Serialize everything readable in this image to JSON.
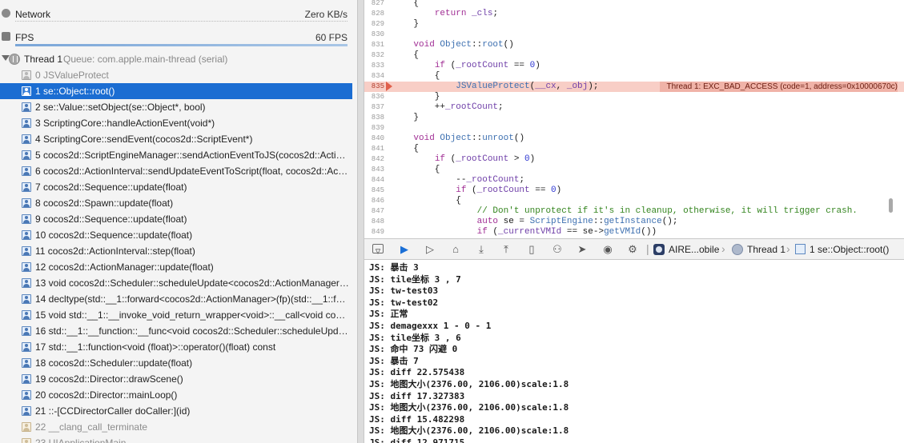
{
  "navigator": {
    "gauges": [
      {
        "name": "Network",
        "value": "Zero KB/s",
        "icon": "network-gauge-icon",
        "level": 0.0
      },
      {
        "name": "FPS",
        "value": "60 FPS",
        "icon": "fps-gauge-icon",
        "level": 1.0
      }
    ],
    "thread": {
      "name": "Thread 1",
      "queue": "Queue: com.apple.main-thread (serial)",
      "icon": "thread-icon"
    },
    "frames": [
      {
        "label": "0 JSValueProtect",
        "style": "dim",
        "icon": "grey"
      },
      {
        "label": "1 se::Object::root()",
        "style": "selected",
        "icon": "blue"
      },
      {
        "label": "2 se::Value::setObject(se::Object*, bool)",
        "style": "normal",
        "icon": "blue"
      },
      {
        "label": "3 ScriptingCore::handleActionEvent(void*)",
        "style": "normal",
        "icon": "blue"
      },
      {
        "label": "4 ScriptingCore::sendEvent(cocos2d::ScriptEvent*)",
        "style": "normal",
        "icon": "blue"
      },
      {
        "label": "5 cocos2d::ScriptEngineManager::sendActionEventToJS(cocos2d::Action...",
        "style": "normal",
        "icon": "blue"
      },
      {
        "label": "6 cocos2d::ActionInterval::sendUpdateEventToScript(float, cocos2d::Acti...",
        "style": "normal",
        "icon": "blue"
      },
      {
        "label": "7 cocos2d::Sequence::update(float)",
        "style": "normal",
        "icon": "blue"
      },
      {
        "label": "8 cocos2d::Spawn::update(float)",
        "style": "normal",
        "icon": "blue"
      },
      {
        "label": "9 cocos2d::Sequence::update(float)",
        "style": "normal",
        "icon": "blue"
      },
      {
        "label": "10 cocos2d::Sequence::update(float)",
        "style": "normal",
        "icon": "blue"
      },
      {
        "label": "11 cocos2d::ActionInterval::step(float)",
        "style": "normal",
        "icon": "blue"
      },
      {
        "label": "12 cocos2d::ActionManager::update(float)",
        "style": "normal",
        "icon": "blue"
      },
      {
        "label": "13 void cocos2d::Scheduler::scheduleUpdate<cocos2d::ActionManager>...",
        "style": "normal",
        "icon": "blue"
      },
      {
        "label": "14 decltype(std::__1::forward<cocos2d::ActionManager>(fp)(std::__1::for...",
        "style": "normal",
        "icon": "blue"
      },
      {
        "label": "15 void std::__1::__invoke_void_return_wrapper<void>::__call<void cocos2...",
        "style": "normal",
        "icon": "blue"
      },
      {
        "label": "16 std::__1::__function::__func<void cocos2d::Scheduler::scheduleUpdate...",
        "style": "normal",
        "icon": "blue"
      },
      {
        "label": "17 std::__1::function<void (float)>::operator()(float) const",
        "style": "normal",
        "icon": "blue"
      },
      {
        "label": "18 cocos2d::Scheduler::update(float)",
        "style": "normal",
        "icon": "blue"
      },
      {
        "label": "19 cocos2d::Director::drawScene()",
        "style": "normal",
        "icon": "blue"
      },
      {
        "label": "20 cocos2d::Director::mainLoop()",
        "style": "normal",
        "icon": "blue"
      },
      {
        "label": "21 ::-[CCDirectorCaller doCaller:](id)",
        "style": "normal",
        "icon": "blue"
      },
      {
        "label": "22 __clang_call_terminate",
        "style": "dim",
        "icon": "tan"
      },
      {
        "label": "23 UIApplicationMain",
        "style": "dim",
        "icon": "tan"
      }
    ]
  },
  "editor": {
    "error_line": "835",
    "error_message": "Thread 1: EXC_BAD_ACCESS (code=1, address=0x10000670c)",
    "lines": [
      {
        "n": "827",
        "html": "    {"
      },
      {
        "n": "828",
        "html": "        <span class=\"kw\">return</span> <span class=\"rf\">_cls</span>;"
      },
      {
        "n": "829",
        "html": "    }"
      },
      {
        "n": "830",
        "html": ""
      },
      {
        "n": "831",
        "html": "    <span class=\"kw\">void</span> <span class=\"ty\">Object</span>::<span class=\"ty\">root</span>()"
      },
      {
        "n": "832",
        "html": "    {"
      },
      {
        "n": "833",
        "html": "        <span class=\"kw\">if</span> (<span class=\"rf\">_rootCount</span> == <span class=\"nm\">0</span>)"
      },
      {
        "n": "834",
        "html": "        {"
      },
      {
        "n": "835",
        "html": "            <span class=\"ty\">JSValueProtect</span>(<span class=\"rf\">__cx</span>, <span class=\"rf\">_obj</span>);"
      },
      {
        "n": "836",
        "html": "        }"
      },
      {
        "n": "837",
        "html": "        ++<span class=\"rf\">_rootCount</span>;"
      },
      {
        "n": "838",
        "html": "    }"
      },
      {
        "n": "839",
        "html": ""
      },
      {
        "n": "840",
        "html": "    <span class=\"kw\">void</span> <span class=\"ty\">Object</span>::<span class=\"ty\">unroot</span>()"
      },
      {
        "n": "841",
        "html": "    {"
      },
      {
        "n": "842",
        "html": "        <span class=\"kw\">if</span> (<span class=\"rf\">_rootCount</span> > <span class=\"nm\">0</span>)"
      },
      {
        "n": "843",
        "html": "        {"
      },
      {
        "n": "844",
        "html": "            --<span class=\"rf\">_rootCount</span>;"
      },
      {
        "n": "845",
        "html": "            <span class=\"kw\">if</span> (<span class=\"rf\">_rootCount</span> == <span class=\"nm\">0</span>)"
      },
      {
        "n": "846",
        "html": "            {"
      },
      {
        "n": "847",
        "html": "                <span class=\"cm\">// Don't unprotect if it's in cleanup, otherwise, it will trigger crash.</span>"
      },
      {
        "n": "848",
        "html": "                <span class=\"kw\">auto</span> se = <span class=\"ty\">ScriptEngine</span>::<span class=\"ty\">getInstance</span>();"
      },
      {
        "n": "849",
        "html": "                <span class=\"kw\">if</span> (<span class=\"rf\">_currentVMId</span> == se-><span class=\"ty\">getVMId</span>())"
      }
    ]
  },
  "debug_bar": {
    "buttons": [
      {
        "name": "hide-debug-area-button",
        "glyph": "▿",
        "active": false,
        "box": true
      },
      {
        "name": "breakpoints-toggle-button",
        "glyph": "▶",
        "active": true,
        "box": false
      },
      {
        "name": "continue-button",
        "glyph": "▷",
        "active": false,
        "box": false
      },
      {
        "name": "step-over-button",
        "glyph": "⌂",
        "active": false,
        "box": false
      },
      {
        "name": "step-into-button",
        "glyph": "⤓",
        "active": false,
        "box": false
      },
      {
        "name": "step-out-button",
        "glyph": "⤒",
        "active": false,
        "box": false
      },
      {
        "name": "view-hierarchy-button",
        "glyph": "▯",
        "active": false,
        "box": false
      },
      {
        "name": "memory-graph-button",
        "glyph": "⚇",
        "active": false,
        "box": false
      },
      {
        "name": "location-button",
        "glyph": "➤",
        "active": false,
        "box": false
      },
      {
        "name": "camera-icon",
        "glyph": "◉",
        "active": false,
        "box": false
      },
      {
        "name": "gear-icon",
        "glyph": "⚙",
        "active": false,
        "box": false
      }
    ],
    "breadcrumb": {
      "app": "AIRE...obile",
      "thread": "Thread 1",
      "frame": "1 se::Object::root()"
    }
  },
  "console": {
    "lines": [
      "JS: 暴击 3",
      "JS: tile坐标 3 , 7",
      "JS: tw-test03",
      "JS: tw-test02",
      "JS: 正常",
      "JS: demagexxx 1 - 0 - 1",
      "JS: tile坐标 3 , 6",
      "JS: 命中 73 闪避 0",
      "JS: 暴击 7",
      "JS: diff 22.575438",
      "JS: 地图大小(2376.00, 2106.00)scale:1.8",
      "JS: diff 17.327383",
      "JS: 地图大小(2376.00, 2106.00)scale:1.8",
      "JS: diff 15.482298",
      "JS: 地图大小(2376.00, 2106.00)scale:1.8",
      "JS: diff 12.971715"
    ]
  }
}
